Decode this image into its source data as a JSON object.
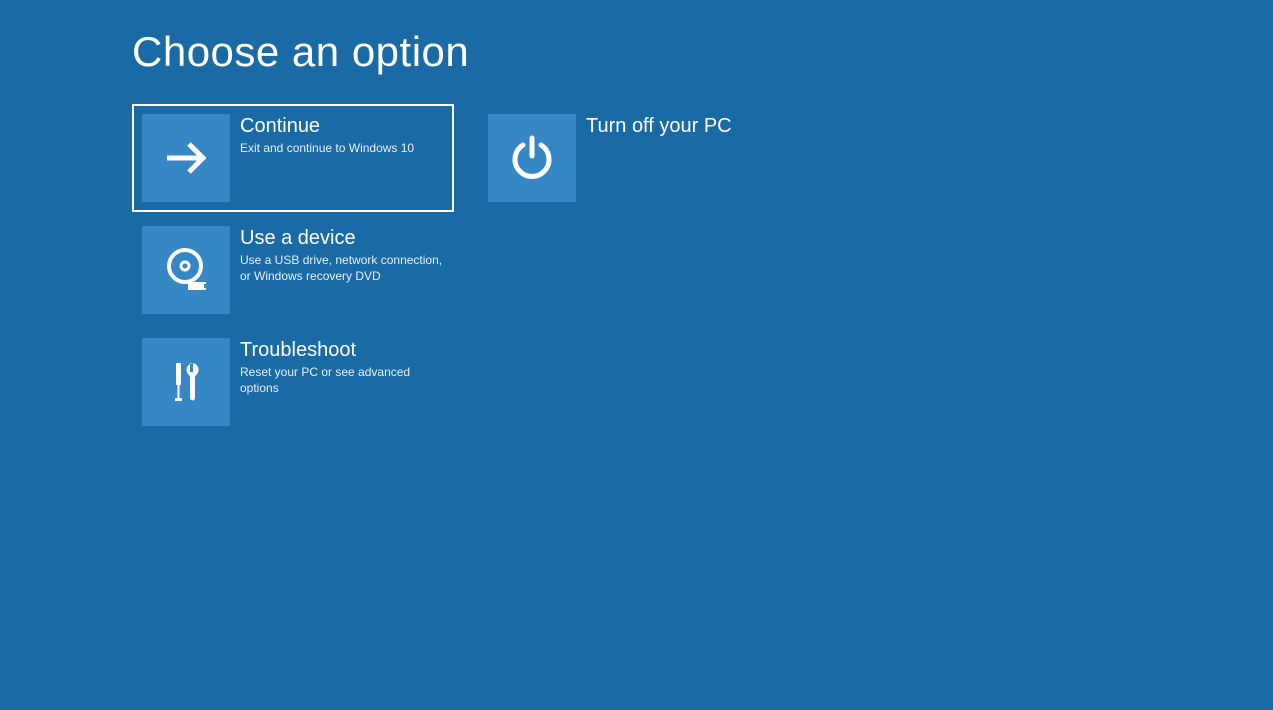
{
  "title": "Choose an option",
  "options": {
    "continue": {
      "title": "Continue",
      "desc": "Exit and continue to Windows 10"
    },
    "turn_off": {
      "title": "Turn off your PC",
      "desc": ""
    },
    "use_device": {
      "title": "Use a device",
      "desc": "Use a USB drive, network connection, or Windows recovery DVD"
    },
    "troubleshoot": {
      "title": "Troubleshoot",
      "desc": "Reset your PC or see advanced options"
    }
  }
}
